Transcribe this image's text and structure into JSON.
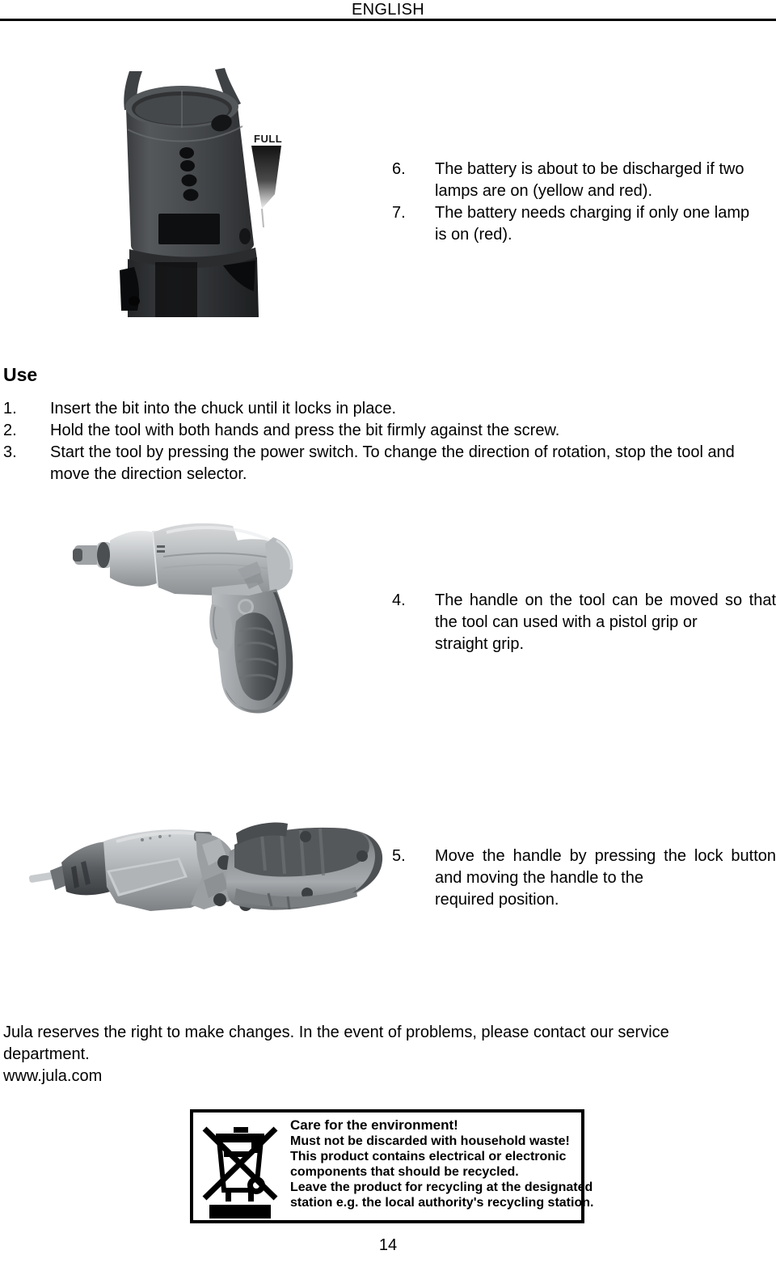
{
  "header": {
    "title": "ENGLISH"
  },
  "battery_notes": {
    "items": [
      {
        "number": "6.",
        "lines": [
          "The battery is about to be discharged if two",
          "lamps are on (yellow and red)."
        ]
      },
      {
        "number": "7.",
        "lines": [
          "The battery needs charging if only one lamp",
          "is on (red)."
        ]
      }
    ]
  },
  "use_section": {
    "heading": "Use",
    "items": [
      {
        "number": "1.",
        "lines": [
          "Insert the bit into the chuck until it locks in place."
        ]
      },
      {
        "number": "2.",
        "lines": [
          "Hold the tool with both hands and press the bit firmly against the screw."
        ]
      },
      {
        "number": "3.",
        "lines": [
          "Start the tool by pressing the power switch. To change the direction of rotation, stop the tool and",
          "move the direction selector."
        ]
      }
    ]
  },
  "handle_notes": {
    "item4": {
      "number": "4.",
      "lines": [
        "The handle on the tool can be moved so",
        "that the tool can used with a pistol grip or",
        "straight grip."
      ]
    },
    "item5": {
      "number": "5.",
      "lines": [
        "Move the handle by pressing the lock",
        "button and moving the handle to the",
        "required position."
      ]
    }
  },
  "images": {
    "battery_indicator": {
      "name": "tool-rear-battery-indicator-photo",
      "label": "FULL"
    },
    "pistol_grip": {
      "name": "cordless-screwdriver-pistol-grip-photo"
    },
    "straight_grip": {
      "name": "cordless-screwdriver-straight-grip-photo"
    }
  },
  "footer": {
    "lines": [
      "Jula reserves the right to make changes. In the event of problems, please contact our service",
      "department.",
      "www.jula.com"
    ]
  },
  "environment_box": {
    "title": "Care for the environment!",
    "lines": [
      "Must not be discarded with household waste!",
      "This product contains electrical or electronic",
      "components that should be recycled.",
      "Leave the product for recycling at the designated",
      "station e.g. the local authority's recycling station."
    ]
  },
  "page_number": "14"
}
